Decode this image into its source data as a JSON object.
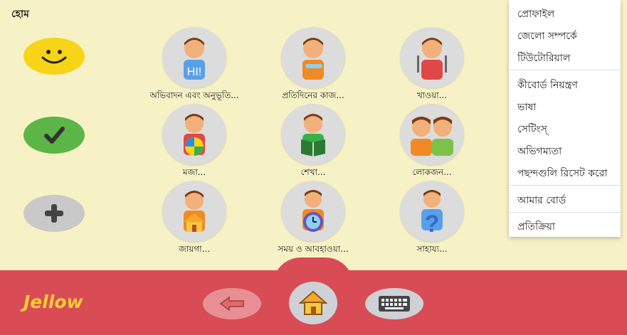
{
  "header": {
    "title": "হোম"
  },
  "side_buttons": [
    {
      "name": "smile-button",
      "icon": "smile-face-icon"
    },
    {
      "name": "check-button",
      "icon": "check-icon"
    },
    {
      "name": "add-button",
      "icon": "plus-icon"
    }
  ],
  "categories": [
    {
      "label": "অভিবাদন এবং অনুভূতি...",
      "icon": "greeting-boy-icon"
    },
    {
      "label": "প্রতিদিনের কাজ...",
      "icon": "daily-activities-boy-icon"
    },
    {
      "label": "খাওয়া...",
      "icon": "eating-boy-icon"
    },
    {
      "label": "মজা...",
      "icon": "fun-boy-ball-icon"
    },
    {
      "label": "শেখা...",
      "icon": "learning-boy-book-icon"
    },
    {
      "label": "লোকজন...",
      "icon": "people-two-kids-icon"
    },
    {
      "label": "জায়গা...",
      "icon": "places-boy-house-icon"
    },
    {
      "label": "সময় ও আবহাওয়া...",
      "icon": "time-weather-boy-clock-icon"
    },
    {
      "label": "সাহায্য...",
      "icon": "help-boy-question-icon"
    }
  ],
  "menu": {
    "items": [
      "প্রোফাইল",
      "জেলো সম্পর্কে",
      "টিউটোরিয়াল",
      "কীবোর্ড নিয়ন্ত্রণ",
      "ভাষা",
      "সেটিংস্",
      "অভিগম্যতা",
      "পছন্দগুলি রিসেট করো",
      "আমার বোর্ড",
      "প্রতিক্রিয়া"
    ]
  },
  "footer": {
    "logo": "Jellow",
    "buttons": [
      {
        "name": "back-button",
        "icon": "back-arrow-icon"
      },
      {
        "name": "home-button",
        "icon": "home-icon"
      },
      {
        "name": "keyboard-button",
        "icon": "keyboard-icon"
      }
    ]
  },
  "colors": {
    "background": "#f7f2c6",
    "footer": "#da4c55",
    "smile_button": "#f7d417",
    "check_button": "#5cb547",
    "add_button": "#c9c9c9",
    "logo": "#f7cb3a"
  }
}
